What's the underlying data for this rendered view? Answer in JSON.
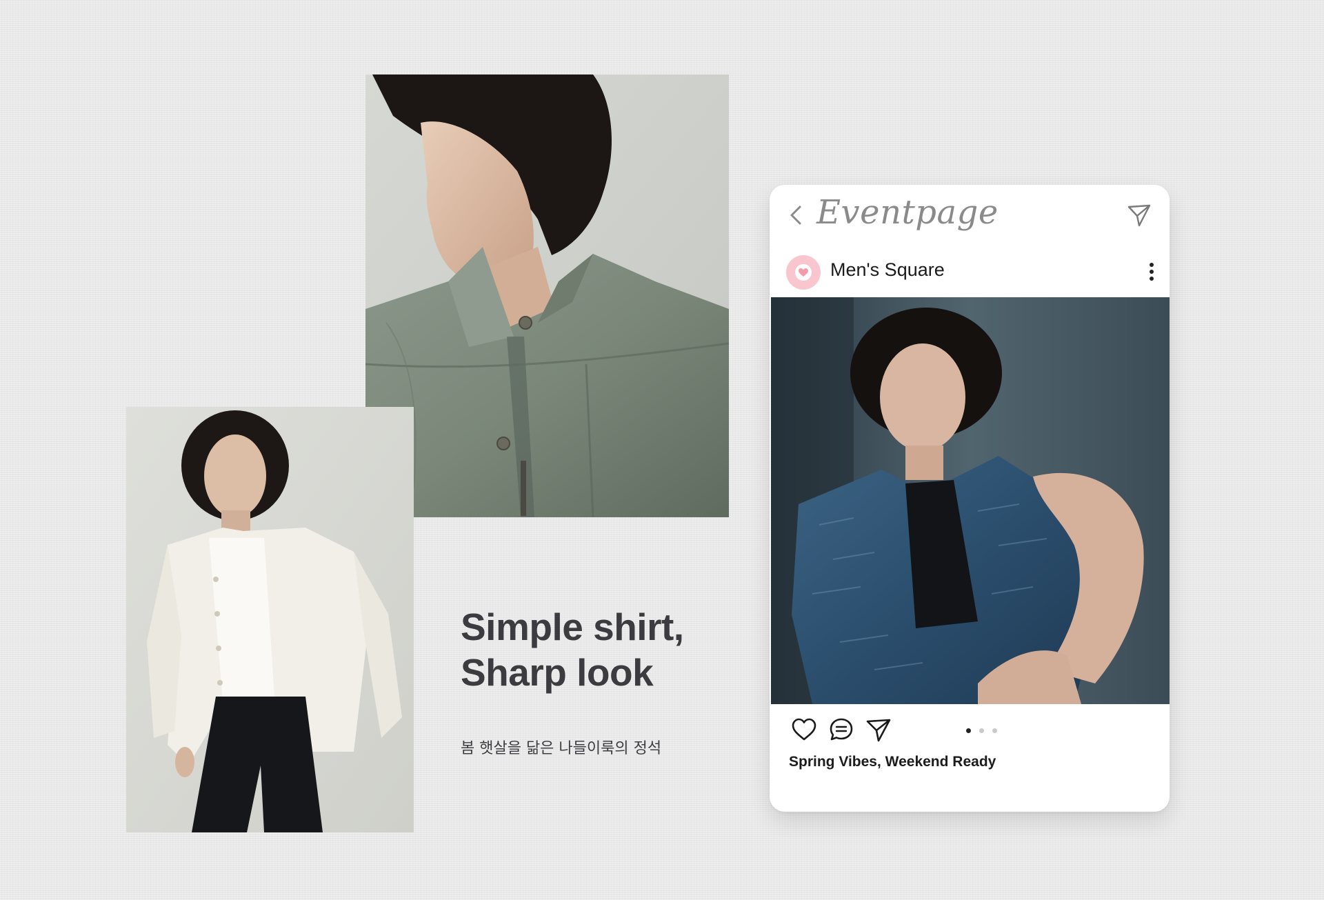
{
  "promo": {
    "headline_line1": "Simple shirt,",
    "headline_line2": "Sharp look",
    "subcopy": "봄 햇살을 닮은 나들이룩의 정석"
  },
  "images": {
    "jacket_alt": "model in olive green zip-up jacket, close-up profile",
    "cardigan_alt": "model in white knit cardigan and black trousers",
    "post_alt": "model seated in blue patterned short-sleeve shirt"
  },
  "event_card": {
    "header": {
      "title": "Eventpage",
      "back_icon": "chevron-left-icon",
      "send_icon": "paper-plane-icon"
    },
    "post": {
      "account_name": "Men's Square",
      "avatar_icon": "heart-icon",
      "more_icon": "more-vertical-icon",
      "actions": [
        "heart-icon",
        "comment-icon",
        "paper-plane-icon"
      ],
      "carousel": {
        "total": 3,
        "active_index": 0
      },
      "caption": "Spring Vibes, Weekend Ready"
    }
  },
  "colors": {
    "background": "#ececec",
    "text_dark": "#3b3b40",
    "avatar_pink": "#f9c6cf",
    "card_bg": "#ffffff"
  }
}
